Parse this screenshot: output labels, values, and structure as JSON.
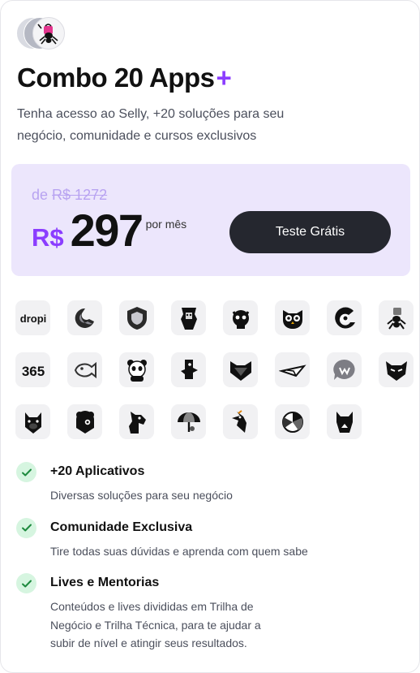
{
  "header": {
    "logos": [
      "avatar-gray",
      "avatar-dark",
      "ant-mascot-icon"
    ]
  },
  "title": {
    "text": "Combo 20 Apps",
    "plus": "+"
  },
  "subtitle": "Tenha acesso ao Selly, +20 soluções para seu negócio, comunidade e cursos exclusivos",
  "pricing": {
    "old_prefix": "de",
    "old_price": "R$ 1272",
    "currency": "R$",
    "amount": "297",
    "period": "por mês",
    "cta_label": "Teste Grátis",
    "box_color": "#ece6fc",
    "accent": "#8b3dff",
    "cta_color": "#25272f"
  },
  "apps": [
    {
      "icon": "dropi-logo-icon",
      "label": "dropi"
    },
    {
      "icon": "bird-head-icon"
    },
    {
      "icon": "shield-icon"
    },
    {
      "icon": "gorilla-icon"
    },
    {
      "icon": "robot-cat-icon"
    },
    {
      "icon": "owl-icon"
    },
    {
      "icon": "chameleon-icon"
    },
    {
      "icon": "ant-shopping-icon"
    },
    {
      "icon": "365-logo-icon",
      "label": "365"
    },
    {
      "icon": "fish-chat-icon"
    },
    {
      "icon": "panda-icon"
    },
    {
      "icon": "bird-icon"
    },
    {
      "icon": "fox-icon"
    },
    {
      "icon": "paper-plane-icon"
    },
    {
      "icon": "chat-bubble-icon"
    },
    {
      "icon": "cat-mask-icon"
    },
    {
      "icon": "pig-icon"
    },
    {
      "icon": "bear-icon"
    },
    {
      "icon": "horse-icon"
    },
    {
      "icon": "umbrella-icon"
    },
    {
      "icon": "woodpecker-icon"
    },
    {
      "icon": "pie-chart-icon"
    },
    {
      "icon": "cat-icon"
    }
  ],
  "features": [
    {
      "title": "+20 Aplicativos",
      "desc": "Diversas soluções para seu negócio"
    },
    {
      "title": "Comunidade Exclusiva",
      "desc": "Tire todas suas dúvidas e aprenda com quem sabe"
    },
    {
      "title": "Lives e Mentorias",
      "desc": "Conteúdos e lives divididas em Trilha de Negócio e Trilha Técnica, para te ajudar a subir de nível e atingir seus resultados."
    }
  ]
}
